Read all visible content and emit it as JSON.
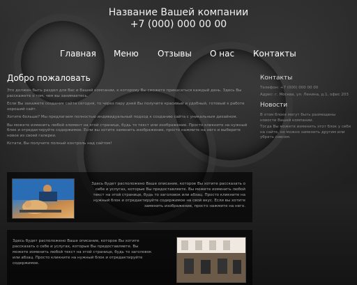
{
  "header": {
    "company": "Название Вашей компании",
    "phone": "+7 (000) 000 00 00"
  },
  "nav": {
    "items": [
      "Главная",
      "Меню",
      "Отзывы",
      "О нас",
      "Контакты"
    ]
  },
  "main": {
    "title": "Добро пожаловать",
    "paragraphs": [
      "Это должен быть раздел для Вас и Вашей компании, к которому Вы сможете прикасаться каждый день. Здесь Вы расскажете о том, чем вы занимаетесь.",
      "Если Вы закажете создание сайта сегодня, то через пару дней Вы получите красивый и удобный, готовый к работе хороший сайт.",
      "Хотите больше? Мы предлагаем полностью индивидуальный подход к созданию сайта с уникальным дизайном.",
      "Вы можете изменить любой элемент на этой странице, будь то текст или изображение. Просто кликните на нужный блок и отредактируйте содержимое. Если вы хотите заменить изображение, просто нажмите на него и выберите новое из своей галереи.",
      "Кстати, Вы получите полный контроль над сайтом!"
    ]
  },
  "sidebar": {
    "contacts_title": "Контакты",
    "phone": "Телефон: +7 (000) 000 00 00",
    "address": "Адрес: г. Москва, ул. Ленина, д.1, офис 203",
    "news_title": "Новости",
    "news": [
      "В этом блоке могут быть размещены новости Вашей компании.",
      "Тогда Вы можете изменить этот блок у себя на сайте, но можно заменить другим или убрать совсем."
    ]
  },
  "feature1": {
    "text": "Здесь будет расположено Ваше описание, которое Вы хотите рассказать о себе и услугах, которые Вы предоставляете. Вы можете изменить любой текст на этой странице, будь то заголовок или абзац. Просто кликните на нужный блок и отредактируйте содержимое на свой вкус. Если вы хотите заменить изображение, просто нажмите на него."
  },
  "feature2": {
    "text": "Здесь будет расположено Ваше описание, которое Вы хотите рассказать о себе и услугах, которые Вы предоставляете. Вы можете изменить любой текст на этой странице, будь то заголовок или абзац. Просто кликните на нужный блок и отредактируйте содержимое."
  }
}
